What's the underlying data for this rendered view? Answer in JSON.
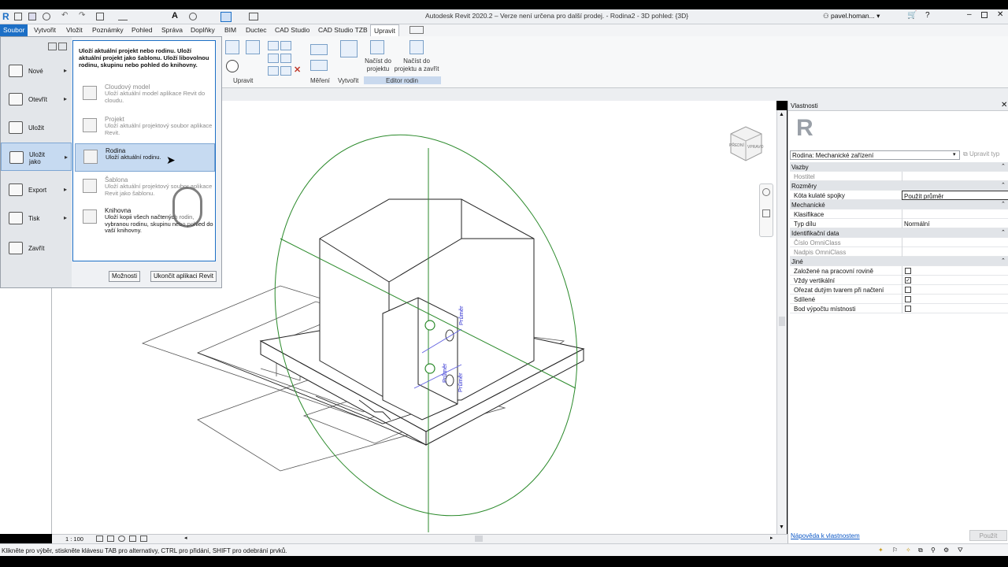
{
  "window": {
    "title": "Autodesk Revit 2020.2 – Verze není určena pro další prodej. - Rodina2 - 3D pohled: {3D}",
    "user": "pavel.homan..."
  },
  "menubar": {
    "tabs": [
      "Soubor",
      "Vytvořit",
      "Vložit",
      "Poznámky",
      "Pohled",
      "Správa",
      "Doplňky",
      "BIM",
      "Ductec",
      "CAD Studio",
      "CAD Studio TZB",
      "Upravit"
    ]
  },
  "ribbon": {
    "panels": [
      "Upravit",
      "Měření",
      "Vytvořit",
      "Editor rodin"
    ],
    "load_project": "Načíst do projektu",
    "load_close": "Načíst do projektu a zavřít"
  },
  "appmenu": {
    "items": [
      {
        "label": "Nové",
        "arrow": "▸"
      },
      {
        "label": "Otevřít",
        "arrow": "▸"
      },
      {
        "label": "Uložit",
        "arrow": ""
      },
      {
        "label": "Uložit jako",
        "arrow": "▸"
      },
      {
        "label": "Export",
        "arrow": "▸"
      },
      {
        "label": "Tisk",
        "arrow": "▸"
      },
      {
        "label": "Zavřít",
        "arrow": ""
      }
    ],
    "submenu_header": "Uloží aktuální projekt nebo rodinu. Uloží aktuální projekt jako šablonu. Uloží libovolnou rodinu, skupinu nebo pohled do knihovny.",
    "submenu": [
      {
        "title": "Cloudový model",
        "desc": "Uloží aktuální model aplikace Revit do cloudu.",
        "enabled": false
      },
      {
        "title": "Projekt",
        "desc": "Uloží aktuální projektový soubor aplikace Revit.",
        "enabled": false
      },
      {
        "title": "Rodina",
        "desc": "Uloží aktuální rodinu.",
        "enabled": true
      },
      {
        "title": "Šablona",
        "desc": "Uloží aktuální projektový soubor aplikace Revit jako šablonu.",
        "enabled": false
      },
      {
        "title": "Knihovna",
        "desc": "Uloží kopii všech načtených rodin, vybranou rodinu, skupinu nebo pohled do vaší knihovny.",
        "enabled": true
      }
    ],
    "options_button": "Možnosti",
    "exit_button": "Ukončit aplikaci Revit"
  },
  "view": {
    "scale": "1 : 100",
    "label_a": "Průměr",
    "label_b": "Průměr",
    "label_c": "Průměr",
    "viewcube_front": "PŘEDNÍ",
    "viewcube_right": "VPRAVO"
  },
  "properties": {
    "title": "Vlastnosti",
    "type_selector": "Rodina: Mechanické zařízení",
    "edit_type": "Upravit typ",
    "rows": [
      {
        "kind": "cat",
        "name": "Vazby"
      },
      {
        "kind": "prop",
        "name": "Hostitel",
        "value": "",
        "dim": true
      },
      {
        "kind": "cat",
        "name": "Rozměry"
      },
      {
        "kind": "prop",
        "name": "Kóta kulaté spojky",
        "value": "Použít průměr"
      },
      {
        "kind": "cat",
        "name": "Mechanické"
      },
      {
        "kind": "prop",
        "name": "Klasifikace",
        "value": ""
      },
      {
        "kind": "prop",
        "name": "Typ dílu",
        "value": "Normální"
      },
      {
        "kind": "cat",
        "name": "Identifikační data"
      },
      {
        "kind": "prop",
        "name": "Číslo OmniClass",
        "value": "",
        "dim": true
      },
      {
        "kind": "prop",
        "name": "Nadpis OmniClass",
        "value": "",
        "dim": true
      },
      {
        "kind": "cat",
        "name": "Jiné"
      },
      {
        "kind": "check",
        "name": "Založené na pracovní rovině",
        "checked": false
      },
      {
        "kind": "check",
        "name": "Vždy vertikální",
        "checked": true
      },
      {
        "kind": "check",
        "name": "Ořezat dutým tvarem při načtení",
        "checked": false
      },
      {
        "kind": "check",
        "name": "Sdílené",
        "checked": false
      },
      {
        "kind": "check",
        "name": "Bod výpočtu místnosti",
        "checked": false
      }
    ],
    "help_link": "Nápověda k vlastnostem",
    "apply_button": "Použít"
  },
  "status": {
    "message": "Klikněte pro výběr, stiskněte klávesu TAB pro alternativy, CTRL pro přidání, SHIFT pro odebrání prvků."
  },
  "colors": {
    "accent": "#1c6fc6",
    "green": "#2b8a2b",
    "dim_label": "#2a2ad0"
  }
}
